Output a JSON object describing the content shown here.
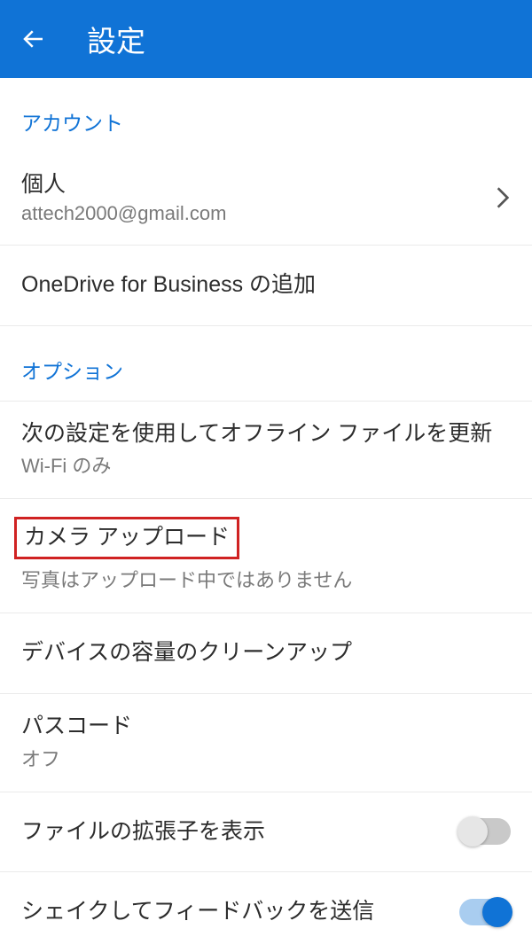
{
  "header": {
    "title": "設定"
  },
  "sections": {
    "account": {
      "header": "アカウント",
      "personal": {
        "title": "個人",
        "email": "attech2000@gmail.com"
      },
      "business": {
        "title": "OneDrive for Business の追加"
      }
    },
    "options": {
      "header": "オプション",
      "offline": {
        "title": "次の設定を使用してオフライン ファイルを更新",
        "value": "Wi-Fi のみ"
      },
      "camera": {
        "title": "カメラ アップロード",
        "status": "写真はアップロード中ではありません"
      },
      "cleanup": {
        "title": "デバイスの容量のクリーンアップ"
      },
      "passcode": {
        "title": "パスコード",
        "value": "オフ"
      },
      "extensions": {
        "title": "ファイルの拡張子を表示",
        "enabled": false
      },
      "shake": {
        "title": "シェイクしてフィードバックを送信",
        "enabled": true
      }
    }
  }
}
